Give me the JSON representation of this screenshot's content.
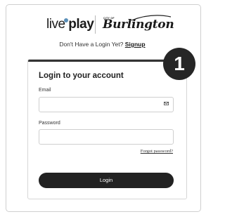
{
  "brand": {
    "liveplay_part1": "live",
    "liveplay_part2": "play",
    "city_label": "CITY OF",
    "city_name": "Burlington"
  },
  "signup": {
    "prompt": "Don't Have a Login Yet?",
    "link": "Signup"
  },
  "step_badge": "1",
  "login_card": {
    "title": "Login to your account",
    "email_label": "Email",
    "email_value": "",
    "password_label": "Password",
    "password_value": "",
    "forgot_link": "Forgot password?",
    "login_button": "Login"
  },
  "colors": {
    "button": "#222222",
    "badge": "#262626",
    "accent_dot": "#5a8fb8"
  }
}
